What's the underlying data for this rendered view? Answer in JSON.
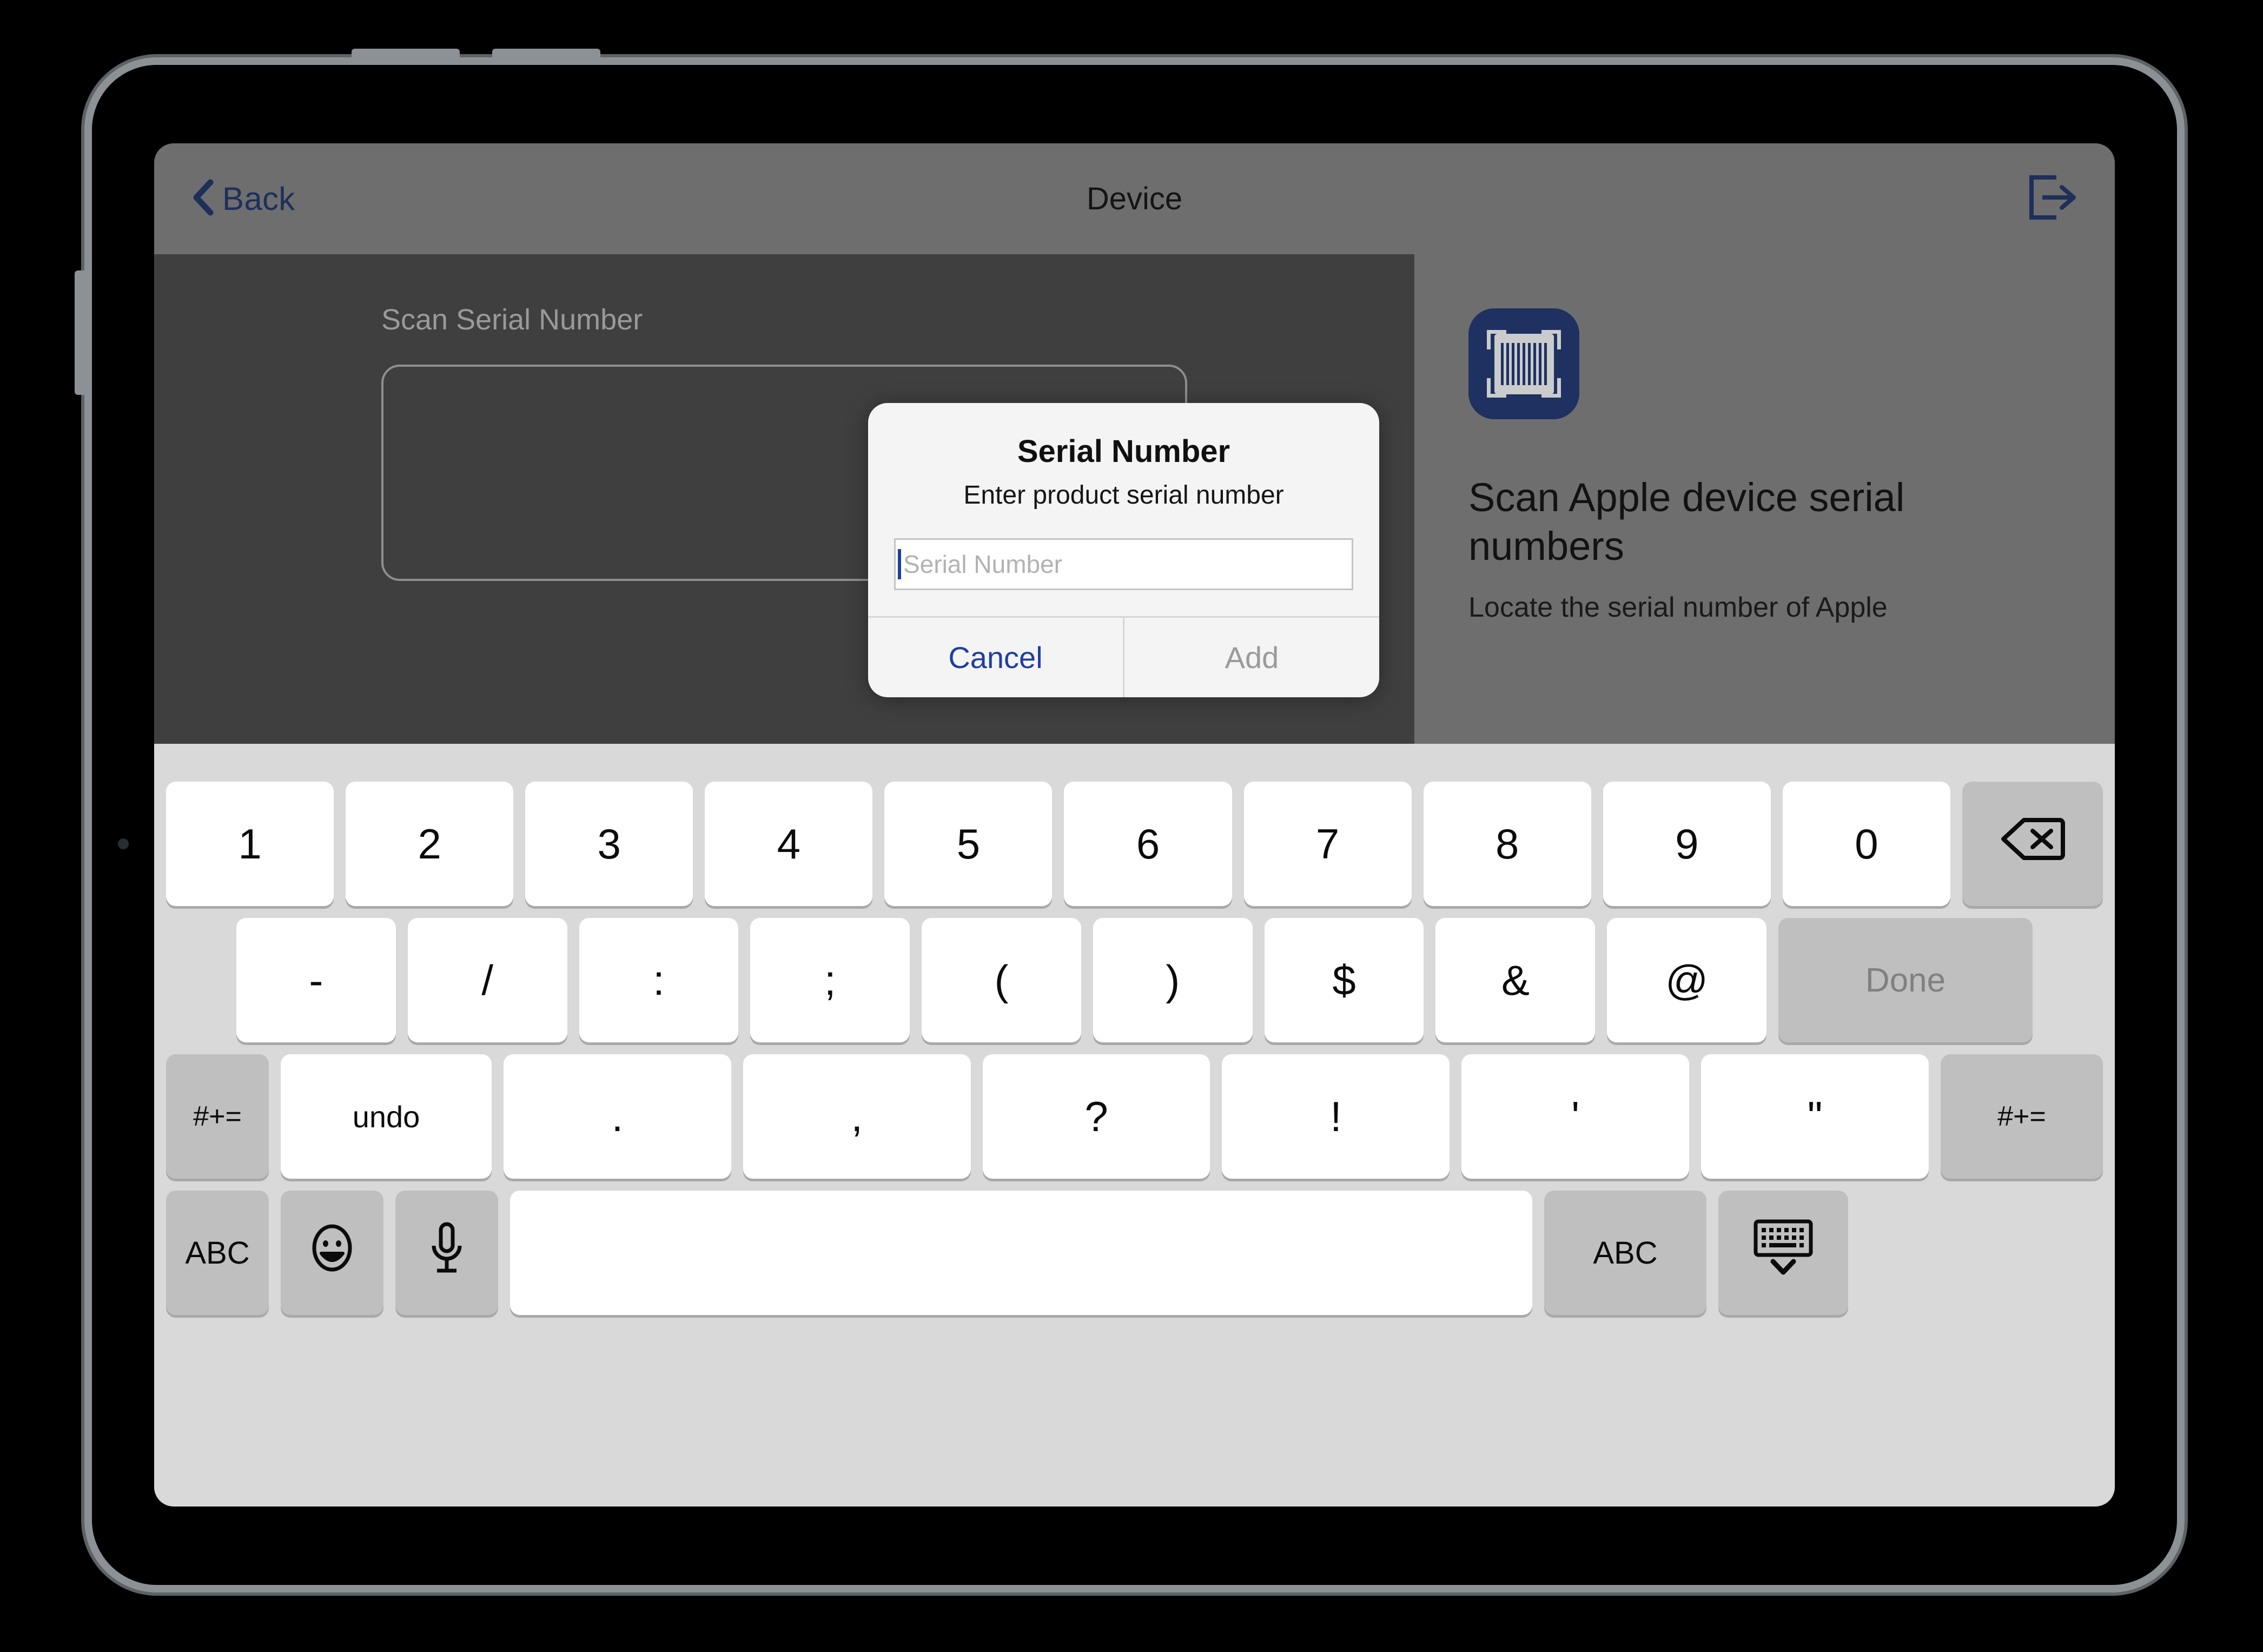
{
  "nav": {
    "back_label": "Back",
    "title": "Device",
    "back_icon": "chevron-left-icon",
    "logout_icon": "logout-icon"
  },
  "left_pane": {
    "scan_label": "Scan Serial Number"
  },
  "right_pane": {
    "icon": "barcode-scan-icon",
    "heading": "Scan Apple device serial numbers",
    "body": "Locate the serial number of Apple"
  },
  "alert": {
    "title": "Serial Number",
    "message": "Enter product serial number",
    "input_value": "",
    "input_placeholder": "Serial Number",
    "cancel_label": "Cancel",
    "add_label": "Add"
  },
  "keyboard": {
    "row1": [
      "1",
      "2",
      "3",
      "4",
      "5",
      "6",
      "7",
      "8",
      "9",
      "0"
    ],
    "backspace_icon": "backspace-icon",
    "row2": [
      "-",
      "/",
      ":",
      ";",
      "(",
      ")",
      "$",
      "&",
      "@"
    ],
    "done_label": "Done",
    "row3_modifier_left": "#+=",
    "undo_label": "undo",
    "row3": [
      ".",
      ",",
      "?",
      "!",
      "'",
      "\""
    ],
    "row3_modifier_right": "#+=",
    "abc_left_label": "ABC",
    "emoji_icon": "emoji-icon",
    "dictation_icon": "microphone-icon",
    "space_label": "",
    "abc_right_label": "ABC",
    "dismiss_icon": "dismiss-keyboard-icon"
  },
  "colors": {
    "accent_navy": "#1e3160",
    "link_blue": "#1e3fa0",
    "nav_bar": "#6e6e6e",
    "content_dark": "#3f3f3f",
    "keyboard_bg": "#d9d9d9",
    "key_white": "#ffffff",
    "key_gray": "#bfbfbf",
    "disabled_gray": "#9a9a9a"
  }
}
